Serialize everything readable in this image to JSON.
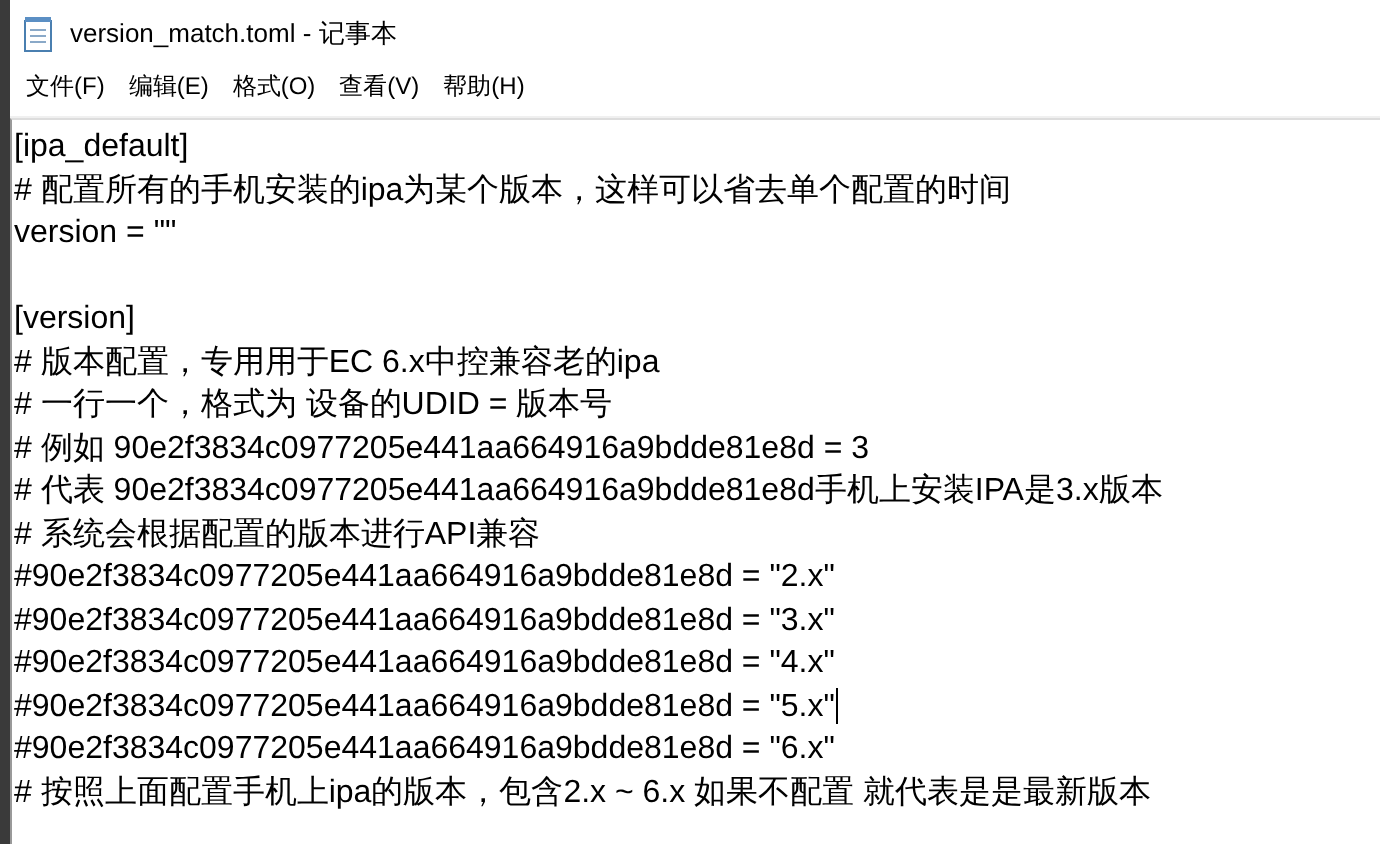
{
  "window": {
    "title": "version_match.toml - 记事本"
  },
  "menu": [
    "文件(F)",
    "编辑(E)",
    "格式(O)",
    "查看(V)",
    "帮助(H)"
  ],
  "editor": {
    "lines": [
      {
        "text": "[ipa_default]",
        "cursor": false
      },
      {
        "text": "# 配置所有的手机安装的ipa为某个版本，这样可以省去单个配置的时间",
        "cursor": false
      },
      {
        "text": "version = \"\"",
        "cursor": false
      },
      {
        "cursor": false
      },
      {
        "text": "[version]",
        "cursor": false
      },
      {
        "text": "# 版本配置，专用用于EC 6.x中控兼容老的ipa",
        "cursor": false
      },
      {
        "text": "# 一行一个，格式为 设备的UDID = 版本号",
        "cursor": false
      },
      {
        "text": "# 例如 90e2f3834c0977205e441aa664916a9bdde81e8d = 3",
        "cursor": false
      },
      {
        "text": "# 代表 90e2f3834c0977205e441aa664916a9bdde81e8d手机上安装IPA是3.x版本",
        "cursor": false
      },
      {
        "text": "# 系统会根据配置的版本进行API兼容",
        "cursor": false
      },
      {
        "text": "#90e2f3834c0977205e441aa664916a9bdde81e8d = \"2.x\"",
        "cursor": false
      },
      {
        "text": "#90e2f3834c0977205e441aa664916a9bdde81e8d = \"3.x\"",
        "cursor": false
      },
      {
        "text": "#90e2f3834c0977205e441aa664916a9bdde81e8d = \"4.x\"",
        "cursor": false
      },
      {
        "text": "#90e2f3834c0977205e441aa664916a9bdde81e8d = \"5.x\"",
        "cursor": true
      },
      {
        "text": "#90e2f3834c0977205e441aa664916a9bdde81e8d = \"6.x\"",
        "cursor": false
      },
      {
        "text": "# 按照上面配置手机上ipa的版本，包含2.x ~ 6.x 如果不配置 就代表是是最新版本",
        "cursor": false
      }
    ]
  }
}
